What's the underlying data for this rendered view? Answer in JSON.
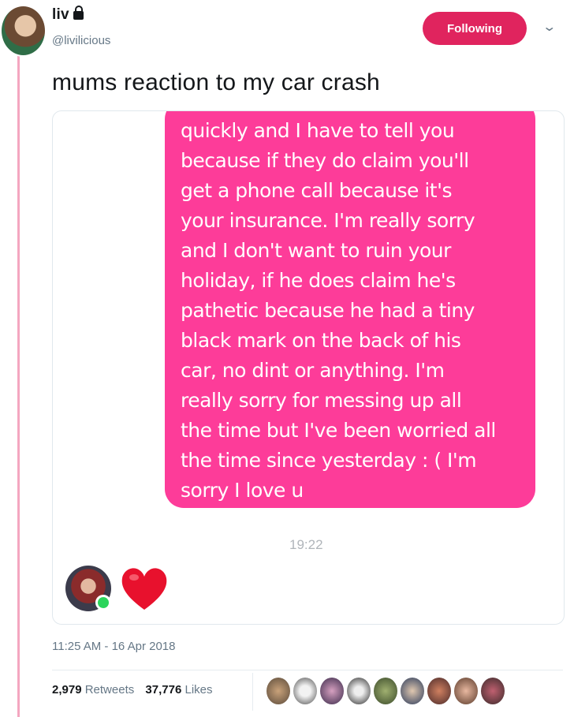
{
  "author": {
    "name": "liv",
    "handle": "@livilicious",
    "follow_label": "Following"
  },
  "tweet": {
    "text": "mums reaction to my car crash",
    "timestamp": "11:25 AM - 16 Apr 2018"
  },
  "message": {
    "lines": [
      "quickly and I have to tell you",
      "because if they do claim you'll",
      "get a phone call because it's",
      "your insurance. I'm really sorry",
      "and I don't want to ruin your",
      "holiday, if he does claim he's",
      "pathetic because he had a tiny",
      "black mark on the back of his",
      "car, no dint or anything. I'm",
      "really sorry for messing up all",
      "the time but I've been worried all",
      "the time since yesterday : ( I'm",
      "sorry I love u"
    ],
    "time": "19:22",
    "reaction": "heart"
  },
  "stats": {
    "retweets_count": "2,979",
    "retweets_label": "Retweets",
    "likes_count": "37,776",
    "likes_label": "Likes"
  },
  "colors": {
    "bubble": "#fd3c99",
    "follow_button": "#e0245e",
    "heart": "#e8112d",
    "online": "#2bd45b"
  },
  "icons": [
    "lock-icon",
    "chevron-down-icon",
    "heart-icon"
  ]
}
